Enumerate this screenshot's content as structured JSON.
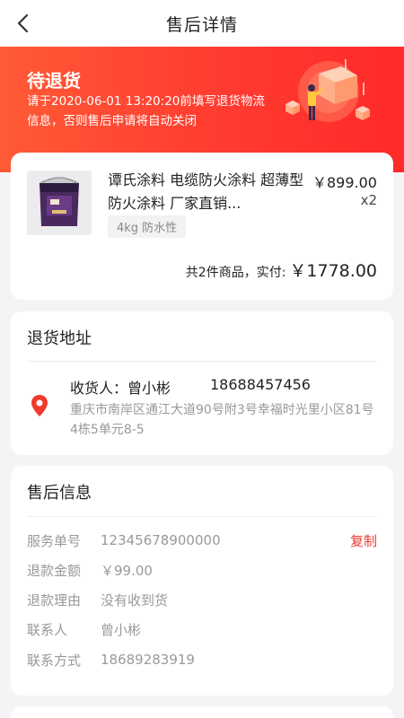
{
  "header": {
    "title": "售后详情"
  },
  "status": {
    "title": "待退货",
    "message": "请于2020-06-01 13:20:20前填写退货物流信息，否则售后申请将自动关闭"
  },
  "product": {
    "name": "谭氏涂料 电缆防火涂料 超薄型防火涂料 厂家直销...",
    "price": "￥899.00",
    "quantity": "x2",
    "spec": "4kg  防水性",
    "total_label": "共2件商品，实付:",
    "total_amount": "￥1778.00"
  },
  "address": {
    "section_title": "退货地址",
    "receiver": "收货人：曾小彬",
    "phone": "18688457456",
    "detail": "重庆市南岸区通江大道90号附3号幸福时光里小区81号4栋5单元8-5"
  },
  "after_sales": {
    "section_title": "售后信息",
    "copy_label": "复制",
    "rows": [
      {
        "label": "服务单号",
        "value": "12345678900000"
      },
      {
        "label": "退款金额",
        "value": "￥99.00"
      },
      {
        "label": "退款理由",
        "value": "没有收到货"
      },
      {
        "label": "联系人",
        "value": "曾小彬"
      },
      {
        "label": "联系方式",
        "value": "18689283919"
      }
    ]
  },
  "colors": {
    "accent": "#ff3b30",
    "copy": "#f03a2e",
    "background": "#f4f4f6"
  },
  "icons": [
    "back-arrow-icon",
    "location-pin-icon"
  ]
}
